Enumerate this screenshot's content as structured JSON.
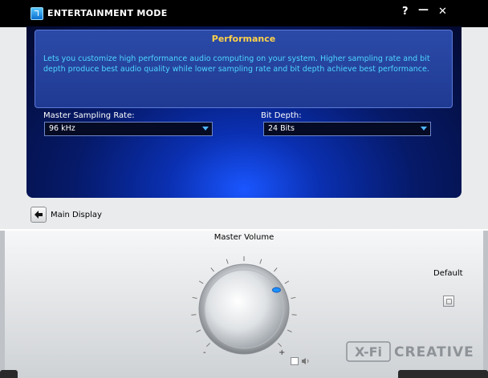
{
  "window": {
    "title": "ENTERTAINMENT MODE",
    "help_label": "?",
    "minimize_label": "—",
    "close_label": "✕"
  },
  "info": {
    "title": "Performance",
    "description": "Lets you customize high performance audio computing on your system. Higher sampling rate and bit depth produce best audio quality while lower sampling rate and bit depth achieve best performance."
  },
  "settings": {
    "sampling_rate_label": "Master Sampling Rate:",
    "sampling_rate_value": "96 kHz",
    "bit_depth_label": "Bit Depth:",
    "bit_depth_value": "24 Bits"
  },
  "nav": {
    "main_display_label": "Main Display"
  },
  "volume": {
    "label": "Master Volume",
    "minus": "-",
    "plus": "+",
    "level_fraction": 0.72
  },
  "default": {
    "label": "Default"
  },
  "brand": {
    "xfi": "X-Fi",
    "creative": "CREATIVE"
  },
  "colors": {
    "accent_blue": "#1a56ff",
    "info_title": "#ffd24a",
    "info_text": "#4fd6ff",
    "indicator": "#1e90ff"
  },
  "icons": {
    "app": "app-icon",
    "back": "arrow-left-icon",
    "mute": "mute-checkbox-icon",
    "speaker": "speaker-icon",
    "default": "reset-icon"
  }
}
